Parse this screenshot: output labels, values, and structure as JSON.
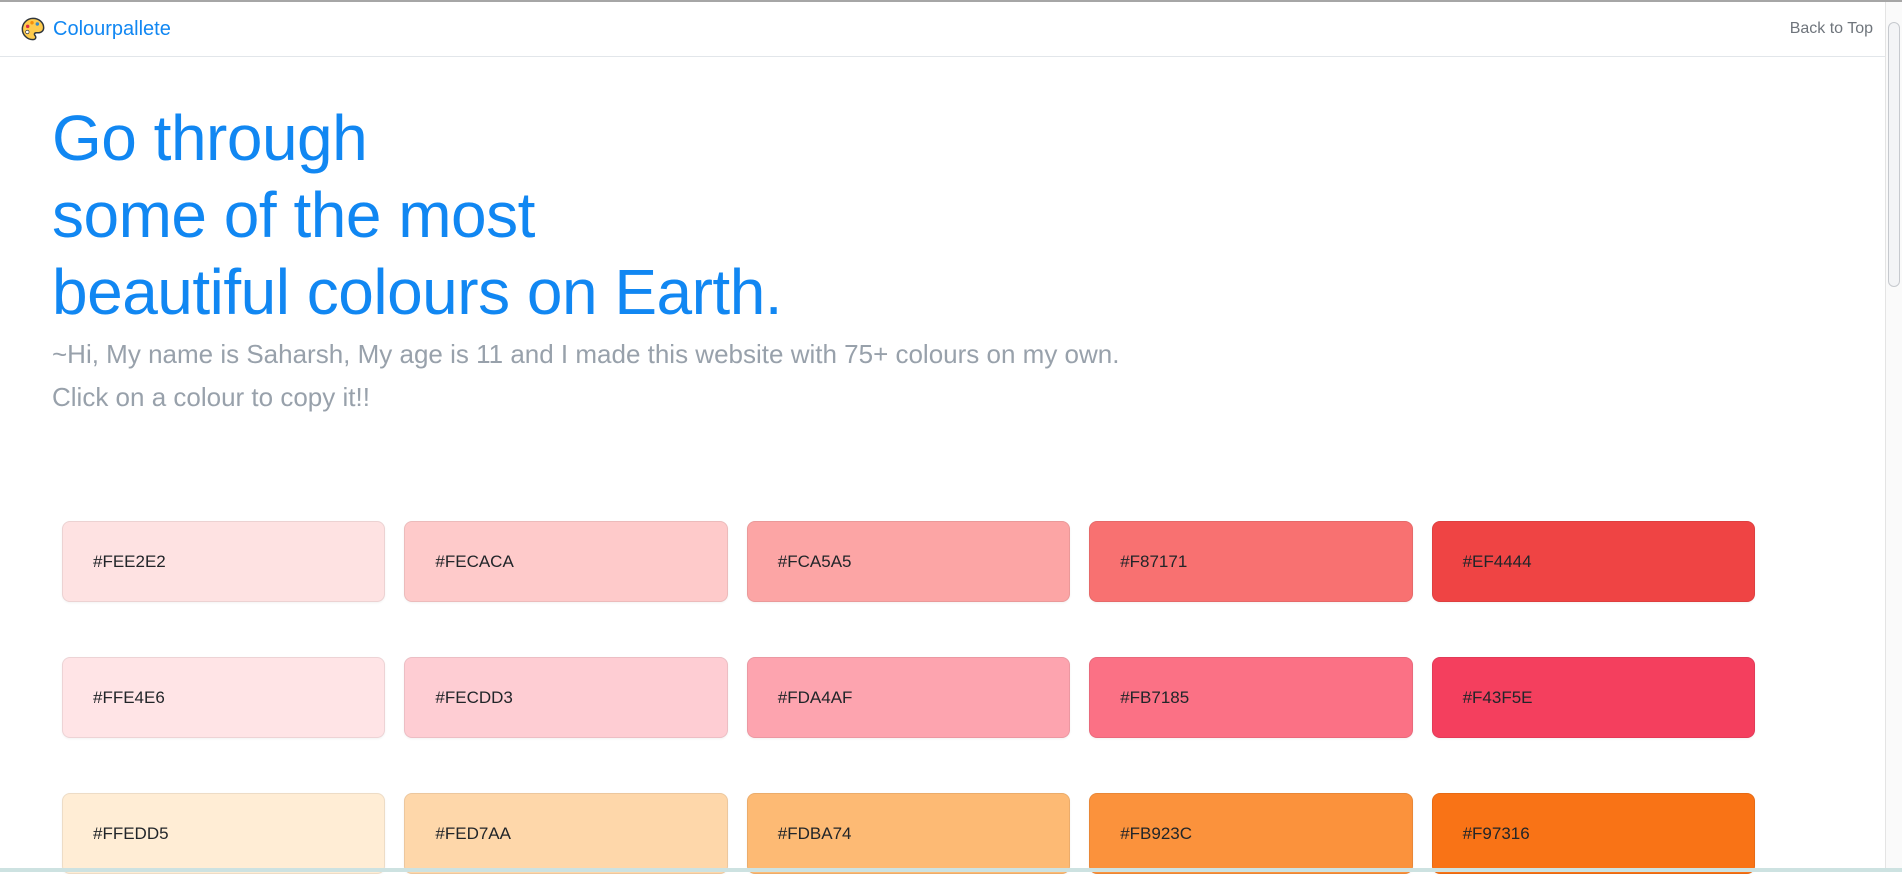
{
  "header": {
    "brand": "Colourpallete",
    "back_to_top": "Back to Top"
  },
  "hero": {
    "heading_line1": "Go through",
    "heading_line2": "some of the most",
    "heading_line3": "beautiful colours on Earth.",
    "subtitle": "~Hi, My name is Saharsh, My age is 11 and I made this website with 75+ colours on my own.",
    "instruction": "Click on a colour to copy it!!"
  },
  "theme": {
    "brand_blue": "#1187f2",
    "muted_gray": "#98a1ab",
    "swatch_text_color": "#212529"
  },
  "swatches": {
    "rows": [
      [
        "#FEE2E2",
        "#FECACA",
        "#FCA5A5",
        "#F87171",
        "#EF4444"
      ],
      [
        "#FFE4E6",
        "#FECDD3",
        "#FDA4AF",
        "#FB7185",
        "#F43F5E"
      ],
      [
        "#FFEDD5",
        "#FED7AA",
        "#FDBA74",
        "#FB923C",
        "#F97316"
      ]
    ]
  }
}
